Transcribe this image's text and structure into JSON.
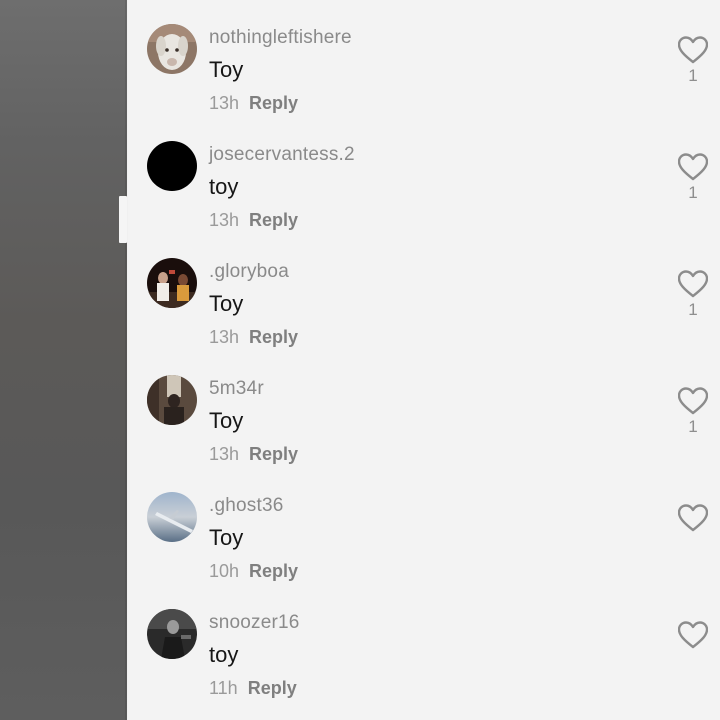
{
  "comments": [
    {
      "username": "nothingleftishere",
      "text": "Toy",
      "time": "13h",
      "reply_label": "Reply",
      "like_count": "1",
      "avatar_icon": "white-dog-avatar-icon"
    },
    {
      "username": "josecervantess.2",
      "text": "toy",
      "time": "13h",
      "reply_label": "Reply",
      "like_count": "1",
      "avatar_icon": "black-circle-avatar-icon"
    },
    {
      "username": ".gloryboa",
      "text": "Toy",
      "time": "13h",
      "reply_label": "Reply",
      "like_count": "1",
      "avatar_icon": "photo-avatar-icon"
    },
    {
      "username": "5m34r",
      "text": "Toy",
      "time": "13h",
      "reply_label": "Reply",
      "like_count": "1",
      "avatar_icon": "photo-avatar-icon"
    },
    {
      "username": ".ghost36",
      "text": "Toy",
      "time": "10h",
      "reply_label": "Reply",
      "like_count": "",
      "avatar_icon": "airplane-wing-avatar-icon"
    },
    {
      "username": "snoozer16",
      "text": "toy",
      "time": "11h",
      "reply_label": "Reply",
      "like_count": "",
      "avatar_icon": "photo-avatar-icon"
    }
  ],
  "colors": {
    "sheet_background": "#f3f3f3",
    "username": "#8a8a8a",
    "comment_text": "#161616",
    "timestamp": "#9a9a9a",
    "reply": "#7f7f7f",
    "heart_outline": "#8c8c8c"
  }
}
